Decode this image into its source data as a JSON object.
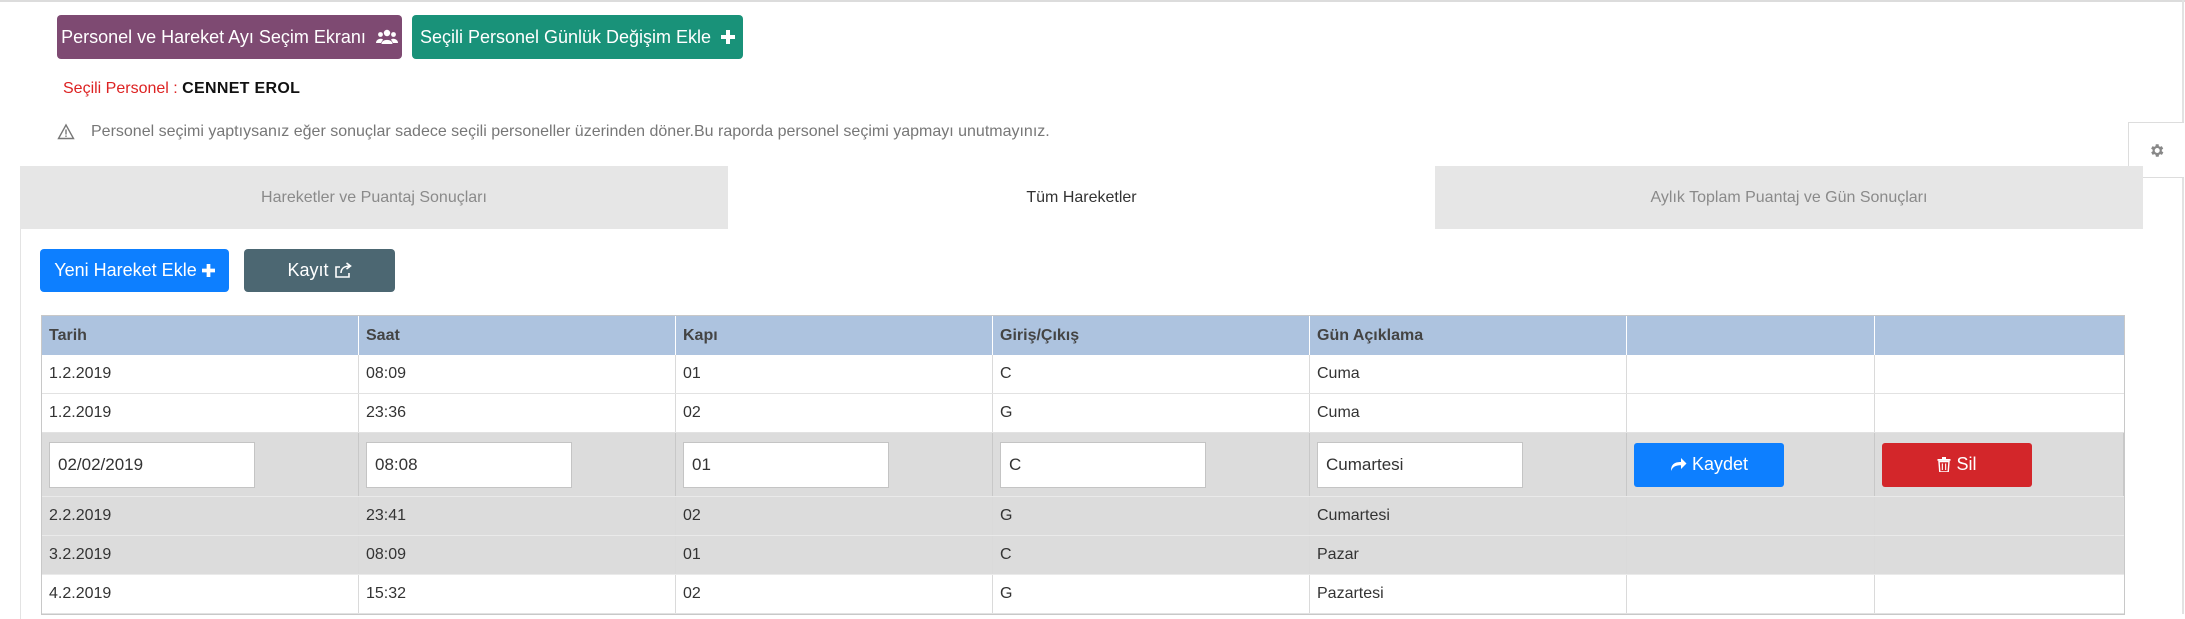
{
  "top_buttons": {
    "personel_label": "Personel ve Hareket Ayı Seçim Ekranı",
    "gunluk_label": "Seçili Personel Günlük Değişim Ekle"
  },
  "selected": {
    "label": "Seçili Personel :",
    "name": "CENNET EROL"
  },
  "warning": "Personel seçimi yaptıysanız eğer sonuçlar sadece seçili personeller üzerinden döner.Bu raporda personel seçimi yapmayı unutmayınız.",
  "tabs": [
    {
      "label": "Hareketler ve Puantaj Sonuçları"
    },
    {
      "label": "Tüm Hareketler"
    },
    {
      "label": "Aylık Toplam Puantaj ve Gün Sonuçları"
    }
  ],
  "actions": {
    "new_label": "Yeni Hareket Ekle",
    "export_label": "Kayıt"
  },
  "table": {
    "headers": [
      "Tarih",
      "Saat",
      "Kapı",
      "Giriş/Çıkış",
      "Gün Açıklama",
      "",
      ""
    ],
    "rows": [
      [
        "1.2.2019",
        "08:09",
        "01",
        "C",
        "Cuma"
      ],
      [
        "1.2.2019",
        "23:36",
        "02",
        "G",
        "Cuma"
      ],
      [
        "2.2.2019",
        "23:41",
        "02",
        "G",
        "Cumartesi"
      ],
      [
        "3.2.2019",
        "08:09",
        "01",
        "C",
        "Pazar"
      ],
      [
        "4.2.2019",
        "15:32",
        "02",
        "G",
        "Pazartesi"
      ]
    ],
    "edit_row": {
      "tarih": "02/02/2019",
      "saat": "08:08",
      "kapi": "01",
      "giris_cikis": "C",
      "gun": "Cumartesi",
      "save_label": "Kaydet",
      "delete_label": "Sil"
    }
  },
  "icons": [
    "users-icon",
    "plus-icon",
    "warning-icon",
    "gear-icon",
    "export-icon",
    "share-icon",
    "trash-icon"
  ],
  "colors": {
    "personel_btn": "#7e4a72",
    "gunluk_btn": "#199279",
    "primary": "#0d7fff",
    "export_btn": "#4c6772",
    "danger": "#d3262a",
    "table_header": "#adc3df"
  }
}
